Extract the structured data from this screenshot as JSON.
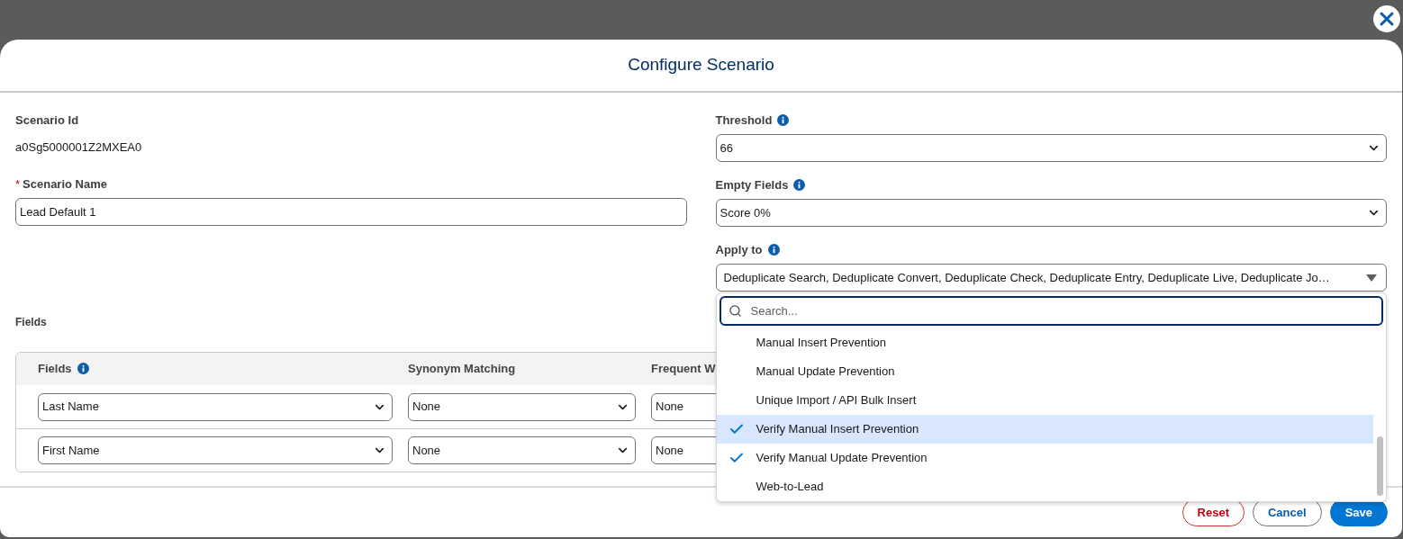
{
  "modal": {
    "title": "Configure Scenario"
  },
  "scenario_id": {
    "label": "Scenario Id",
    "value": "a0Sg5000001Z2MXEA0"
  },
  "scenario_name": {
    "label": "Scenario Name",
    "required_mark": "*",
    "value": "Lead Default 1"
  },
  "threshold": {
    "label": "Threshold",
    "value": "66"
  },
  "empty_fields": {
    "label": "Empty Fields",
    "value": "Score 0%"
  },
  "apply_to": {
    "label": "Apply to",
    "value": "Deduplicate Search, Deduplicate Convert, Deduplicate Check, Deduplicate Entry, Deduplicate Live, Deduplicate Jo…",
    "expanded": true,
    "search_placeholder": "Search...",
    "options": [
      {
        "label": "Manual Insert Prevention",
        "checked": false,
        "highlighted": false
      },
      {
        "label": "Manual Update Prevention",
        "checked": false,
        "highlighted": false
      },
      {
        "label": "Unique Import / API Bulk Insert",
        "checked": false,
        "highlighted": false
      },
      {
        "label": "Verify Manual Insert Prevention",
        "checked": true,
        "highlighted": true
      },
      {
        "label": "Verify Manual Update Prevention",
        "checked": true,
        "highlighted": false
      },
      {
        "label": "Web-to-Lead",
        "checked": false,
        "highlighted": false
      }
    ]
  },
  "fields_section": {
    "label": "Fields",
    "columns": [
      "Fields",
      "Synonym Matching",
      "Frequent W"
    ],
    "rows": [
      [
        "Last Name",
        "None",
        "None"
      ],
      [
        "First Name",
        "None",
        "None"
      ]
    ]
  },
  "footer": {
    "buttons": [
      {
        "label": "Reset",
        "kind": "destructive"
      },
      {
        "label": "Cancel",
        "kind": "neutral"
      },
      {
        "label": "Save",
        "kind": "brand"
      }
    ]
  }
}
